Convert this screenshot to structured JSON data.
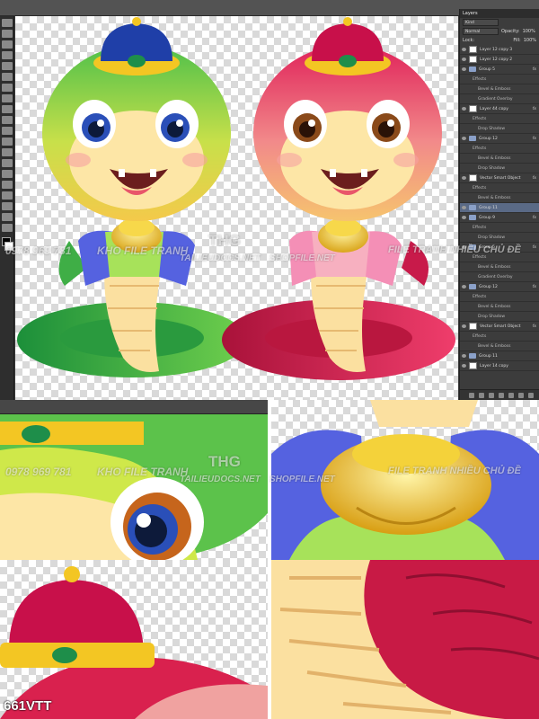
{
  "photoshop": {
    "layers_panel": {
      "title": "Layers",
      "kind_filter": "Kind",
      "blend_mode": "Normal",
      "opacity_label": "Opacity:",
      "opacity_value": "100%",
      "lock_label": "Lock:",
      "fill_label": "Fill:",
      "fill_value": "100%",
      "items": [
        {
          "label": "Layer 12 copy 3",
          "kind": "layer"
        },
        {
          "label": "Layer 12 copy 2",
          "kind": "layer"
        },
        {
          "label": "Group 5",
          "kind": "group",
          "fx": "fx"
        },
        {
          "label": "Effects",
          "kind": "fx"
        },
        {
          "label": "Bevel & Emboss",
          "kind": "fx2"
        },
        {
          "label": "Gradient Overlay",
          "kind": "fx2"
        },
        {
          "label": "Layer 44 copy",
          "kind": "layer",
          "fx": "fx"
        },
        {
          "label": "Effects",
          "kind": "fx"
        },
        {
          "label": "Drop Shadow",
          "kind": "fx2"
        },
        {
          "label": "Group 12",
          "kind": "group",
          "fx": "fx"
        },
        {
          "label": "Effects",
          "kind": "fx"
        },
        {
          "label": "Bevel & Emboss",
          "kind": "fx2"
        },
        {
          "label": "Drop Shadow",
          "kind": "fx2"
        },
        {
          "label": "Vector Smart Object",
          "kind": "layer",
          "fx": "fx"
        },
        {
          "label": "Effects",
          "kind": "fx"
        },
        {
          "label": "Bevel & Emboss",
          "kind": "fx2"
        },
        {
          "label": "Group 11",
          "kind": "group",
          "selected": true
        },
        {
          "label": "Group 9",
          "kind": "group",
          "fx": "fx"
        },
        {
          "label": "Effects",
          "kind": "fx"
        },
        {
          "label": "Drop Shadow",
          "kind": "fx2"
        },
        {
          "label": "Group 5",
          "kind": "group",
          "fx": "fx"
        },
        {
          "label": "Effects",
          "kind": "fx"
        },
        {
          "label": "Bevel & Emboss",
          "kind": "fx2"
        },
        {
          "label": "Gradient Overlay",
          "kind": "fx2"
        },
        {
          "label": "Group 12",
          "kind": "group",
          "fx": "fx"
        },
        {
          "label": "Effects",
          "kind": "fx"
        },
        {
          "label": "Bevel & Emboss",
          "kind": "fx2"
        },
        {
          "label": "Drop Shadow",
          "kind": "fx2"
        },
        {
          "label": "Vector Smart Object",
          "kind": "layer",
          "fx": "fx"
        },
        {
          "label": "Effects",
          "kind": "fx"
        },
        {
          "label": "Bevel & Emboss",
          "kind": "fx2"
        },
        {
          "label": "Group 11",
          "kind": "group"
        },
        {
          "label": "Layer 14 copy",
          "kind": "layer"
        }
      ]
    }
  },
  "watermark": {
    "phone": "0978 969 781",
    "shop_name": "KHO FILE TRANH",
    "logo_text": "THG",
    "site_1": "TAILIEUDOCS.NET",
    "site_2": "SHOPFILE.NET",
    "tagline": "FILE TRANH NHIỀU CHỦ ĐỀ"
  },
  "product_code": "661VTT",
  "colors": {
    "green_snake": "#39b54a",
    "red_snake": "#d9214e",
    "hat_blue": "#1f3fa8",
    "hat_red": "#c8104a",
    "gold": "#f3c623",
    "belly": "#fbe3a0"
  }
}
